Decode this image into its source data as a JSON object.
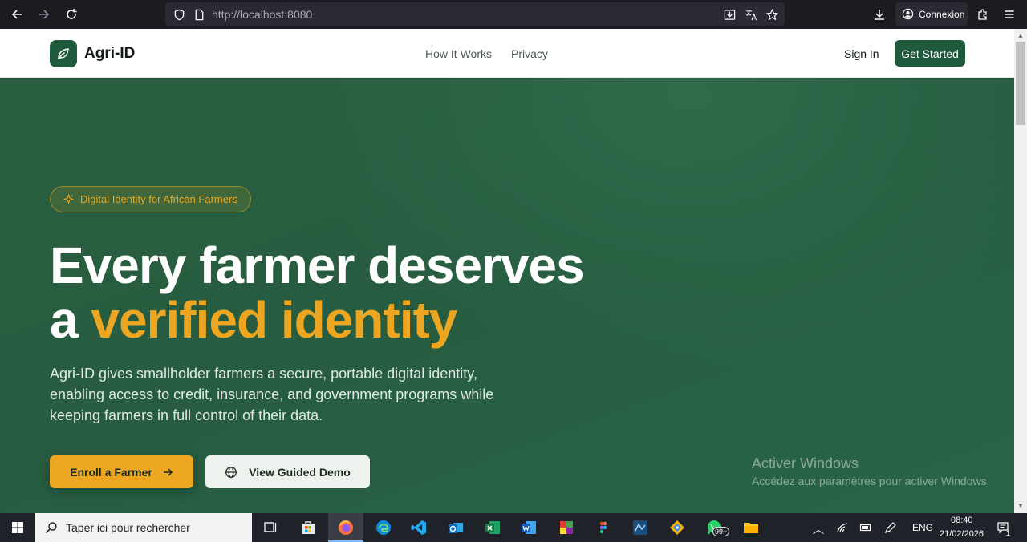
{
  "browser": {
    "url_host": "http://localhost",
    "url_port": ":8080",
    "connexion_label": "Connexion"
  },
  "site": {
    "brand": "Agri-ID",
    "nav": [
      "How It Works",
      "Privacy"
    ],
    "sign_in": "Sign In",
    "get_started": "Get Started"
  },
  "hero": {
    "badge": "Digital Identity for African Farmers",
    "headline_line1": "Every farmer deserves",
    "headline_a": "a ",
    "headline_accent": "verified identity",
    "subtext": "Agri-ID gives smallholder farmers a secure, portable digital identity, enabling access to credit, insurance, and government programs while keeping farmers in full control of their data.",
    "enroll_button": "Enroll a Farmer",
    "demo_button": "View Guided Demo"
  },
  "watermark": {
    "title": "Activer Windows",
    "subtitle": "Accédez aux paramètres pour activer Windows."
  },
  "taskbar": {
    "search_placeholder": "Taper ici pour rechercher",
    "whatsapp_badge": "99+",
    "language": "ENG",
    "time": "08:40",
    "date": "21/02/2026",
    "notification_count": "1"
  },
  "colors": {
    "brand_green": "#1f5a3c",
    "accent_gold": "#eca622"
  }
}
